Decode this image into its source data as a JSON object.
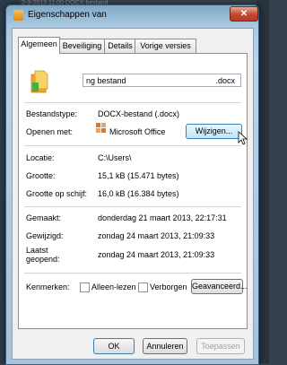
{
  "background": {
    "behind_text": "2-3-2013 11:00   DOCX-bestand"
  },
  "window": {
    "title": "Eigenschappen van",
    "close_glyph": "✕"
  },
  "tabs": [
    {
      "label": "Algemeen",
      "active": true
    },
    {
      "label": "Beveiliging",
      "active": false
    },
    {
      "label": "Details",
      "active": false
    },
    {
      "label": "Vorige versies",
      "active": false
    }
  ],
  "file": {
    "name": "ng bestand",
    "extension": ".docx"
  },
  "props": {
    "type_label": "Bestandstype:",
    "type_value": "DOCX-bestand (.docx)",
    "opens_label": "Openen met:",
    "opens_value": "Microsoft Office",
    "change_button": "Wijzigen...",
    "location_label": "Locatie:",
    "location_value": "C:\\Users\\",
    "size_label": "Grootte:",
    "size_value": "15,1 kB (15.471 bytes)",
    "disk_label": "Grootte op schijf:",
    "disk_value": "16,0 kB (16.384 bytes)",
    "created_label": "Gemaakt:",
    "created_value": "donderdag 21 maart 2013, 22:17:31",
    "modified_label": "Gewijzigd:",
    "modified_value": "zondag 24 maart 2013, 21:09:33",
    "accessed_label_1": "Laatst",
    "accessed_label_2": "geopend:",
    "accessed_value": "zondag 24 maart 2013, 21:09:33",
    "attributes_label": "Kenmerken:",
    "readonly_label": "Alleen-lezen",
    "hidden_label": "Verborgen",
    "advanced_button": "Geavanceerd..."
  },
  "footer": {
    "ok": "OK",
    "cancel": "Annuleren",
    "apply": "Toepassen"
  },
  "colors": {
    "accent_blue": "#3c7fb1",
    "office_orange": "#e8741c"
  }
}
